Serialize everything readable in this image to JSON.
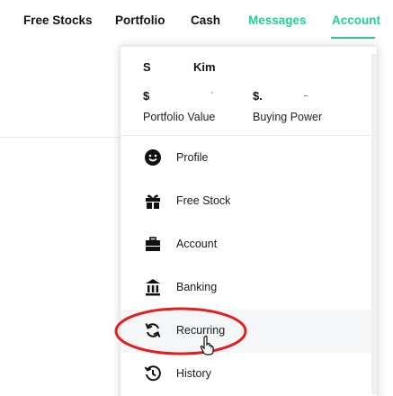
{
  "nav": {
    "items": [
      {
        "label": "Free Stocks"
      },
      {
        "label": "Portfolio"
      },
      {
        "label": "Cash"
      },
      {
        "label": "Messages"
      },
      {
        "label": "Account"
      }
    ]
  },
  "account_menu": {
    "name_prefix": "S",
    "user_name": "Kim",
    "portfolio_value": "$",
    "buying_power": "$.",
    "portfolio_value_label": "Portfolio Value",
    "buying_power_label": "Buying Power",
    "items": [
      {
        "label": "Profile",
        "icon": "smiley-icon"
      },
      {
        "label": "Free Stock",
        "icon": "gift-icon"
      },
      {
        "label": "Account",
        "icon": "briefcase-icon"
      },
      {
        "label": "Banking",
        "icon": "bank-icon"
      },
      {
        "label": "Recurring",
        "icon": "refresh-icon"
      },
      {
        "label": "History",
        "icon": "history-icon"
      }
    ]
  },
  "colors": {
    "accent": "#21ce99",
    "annotation": "#e0201c",
    "hover_row": "#f4f6f8"
  }
}
